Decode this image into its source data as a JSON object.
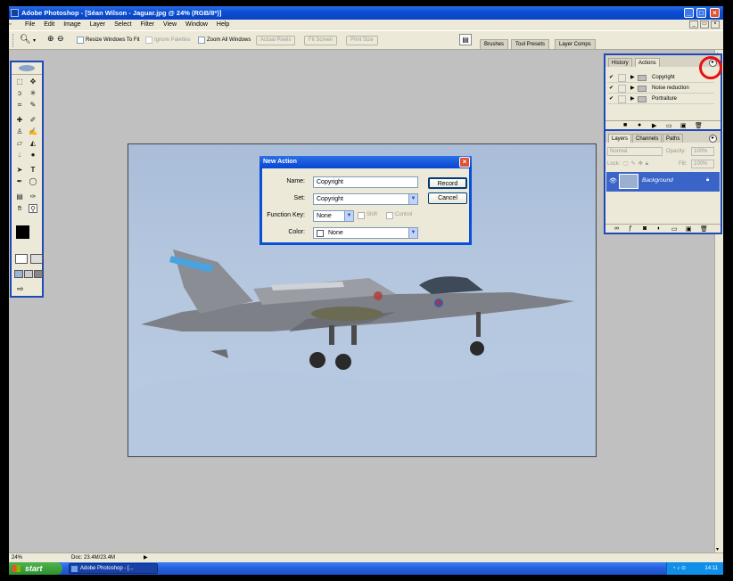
{
  "window": {
    "title": "Adobe Photoshop - [Séan Wilson - Jaguar.jpg @ 24% (RGB/8*)]"
  },
  "menu": [
    "File",
    "Edit",
    "Image",
    "Layer",
    "Select",
    "Filter",
    "View",
    "Window",
    "Help"
  ],
  "options": {
    "resize_windows": "Resize Windows To Fit",
    "ignore_palettes": "Ignore Palettes",
    "zoom_all": "Zoom All Windows",
    "actual_pixels": "Actual Pixels",
    "fit_screen": "Fit Screen",
    "print_size": "Print Size",
    "well_tabs": [
      "Brushes",
      "Tool Presets",
      "Layer Comps"
    ]
  },
  "dialog": {
    "title": "New Action",
    "name_label": "Name:",
    "name_value": "Copyright",
    "set_label": "Set:",
    "set_value": "Copyright",
    "function_key_label": "Function Key:",
    "function_key_value": "None",
    "shift_label": "Shift",
    "control_label": "Control",
    "color_label": "Color:",
    "color_value": "None",
    "record_button": "Record",
    "cancel_button": "Cancel"
  },
  "actions_panel": {
    "tabs": [
      "History",
      "Actions"
    ],
    "active_tab": "Actions",
    "items": [
      "Copyright",
      "Noise reduction",
      "Portraiture"
    ]
  },
  "layers_panel": {
    "tabs": [
      "Layers",
      "Channels",
      "Paths"
    ],
    "blend_mode": "Normal",
    "opacity_label": "Opacity:",
    "opacity_value": "100%",
    "lock_label": "Lock:",
    "fill_label": "Fill:",
    "fill_value": "100%",
    "layer_name": "Background"
  },
  "status": {
    "zoom": "24%",
    "doc": "Doc: 23.4M/23.4M"
  },
  "taskbar": {
    "start": "start",
    "task": "Adobe Photoshop - [...",
    "time": "14:11"
  },
  "colors": {
    "xp_blue": "#0a4fd6",
    "highlight_circle": "#e81010",
    "layer_selected": "#3a64c8"
  }
}
